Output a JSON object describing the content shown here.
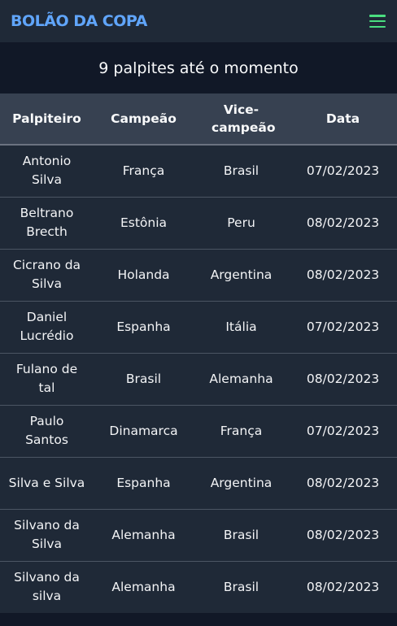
{
  "header": {
    "logo": "BOLÃO DA COPA",
    "menu_icon": "hamburger-menu-icon",
    "colors": {
      "logo": "#60a5fa",
      "menu": "#4ade80"
    }
  },
  "summary": "9 palpites até o momento",
  "table": {
    "columns": [
      "Palpiteiro",
      "Campeão",
      "Vice-campeão",
      "Data"
    ],
    "rows": [
      [
        "Antonio Silva",
        "França",
        "Brasil",
        "07/02/2023"
      ],
      [
        "Beltrano Brecth",
        "Estônia",
        "Peru",
        "08/02/2023"
      ],
      [
        "Cicrano da Silva",
        "Holanda",
        "Argentina",
        "08/02/2023"
      ],
      [
        "Daniel Lucrédio",
        "Espanha",
        "Itália",
        "07/02/2023"
      ],
      [
        "Fulano de tal",
        "Brasil",
        "Alemanha",
        "08/02/2023"
      ],
      [
        "Paulo Santos",
        "Dinamarca",
        "França",
        "07/02/2023"
      ],
      [
        "Silva e Silva",
        "Espanha",
        "Argentina",
        "08/02/2023"
      ],
      [
        "Silvano da Silva",
        "Alemanha",
        "Brasil",
        "08/02/2023"
      ],
      [
        "Silvano da silva",
        "Alemanha",
        "Brasil",
        "08/02/2023"
      ]
    ]
  }
}
